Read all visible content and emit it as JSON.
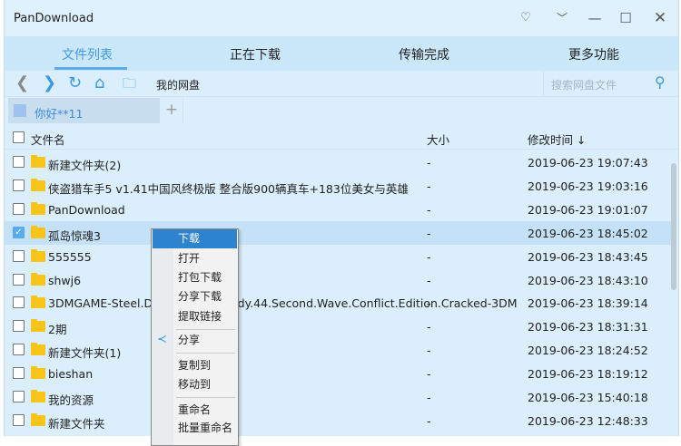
{
  "window": {
    "title": "PanDownload"
  },
  "tabs": [
    "文件列表",
    "正在下载",
    "传输完成",
    "更多功能"
  ],
  "toolbar": {
    "path": "我的网盘",
    "search_placeholder": "搜索网盘文件"
  },
  "user_tab": {
    "name": "你好**11",
    "add": "+"
  },
  "columns": {
    "name": "文件名",
    "size": "大小",
    "modified": "修改时间 ↓"
  },
  "rows": [
    {
      "name": "新建文件夹(2)",
      "size": "-",
      "modified": "2019-06-23 19:07:43",
      "checked": false
    },
    {
      "name": "侠盗猎车手5 v1.41中国风终极版 整合版900辆真车+183位美女与英雄",
      "size": "-",
      "modified": "2019-06-23 19:03:16",
      "checked": false
    },
    {
      "name": "PanDownload",
      "size": "-",
      "modified": "2019-06-23 19:01:07",
      "checked": false
    },
    {
      "name": "孤岛惊魂3",
      "size": "-",
      "modified": "2019-06-23 18:45:02",
      "checked": true
    },
    {
      "name": "555555",
      "size": "-",
      "modified": "2019-06-23 18:43:45",
      "checked": false
    },
    {
      "name": "shwj6",
      "size": "-",
      "modified": "2019-06-23 18:43:10",
      "checked": false
    },
    {
      "name": "3DMGAME-Steel.Division.Normandy.44.Second.Wave.Conflict.Edition.Cracked-3DM",
      "size": "-",
      "modified": "2019-06-23 18:39:14",
      "checked": false
    },
    {
      "name": "2期",
      "size": "-",
      "modified": "2019-06-23 18:31:31",
      "checked": false
    },
    {
      "name": "新建文件夹(1)",
      "size": "-",
      "modified": "2019-06-23 18:24:52",
      "checked": false
    },
    {
      "name": "bieshan",
      "size": "-",
      "modified": "2019-06-23 18:19:12",
      "checked": false
    },
    {
      "name": "我的资源",
      "size": "-",
      "modified": "2019-06-23 15:40:18",
      "checked": false
    },
    {
      "name": "新建文件夹",
      "size": "-",
      "modified": "2019-06-23 12:48:33",
      "checked": false
    }
  ],
  "context_menu": [
    "下载",
    "打开",
    "打包下载",
    "分享下载",
    "提取链接",
    "分享",
    "复制到",
    "移动到",
    "重命名",
    "批量重命名"
  ],
  "colors": {
    "accent": "#3f9ae6",
    "menu_highlight": "#2e83cf"
  }
}
